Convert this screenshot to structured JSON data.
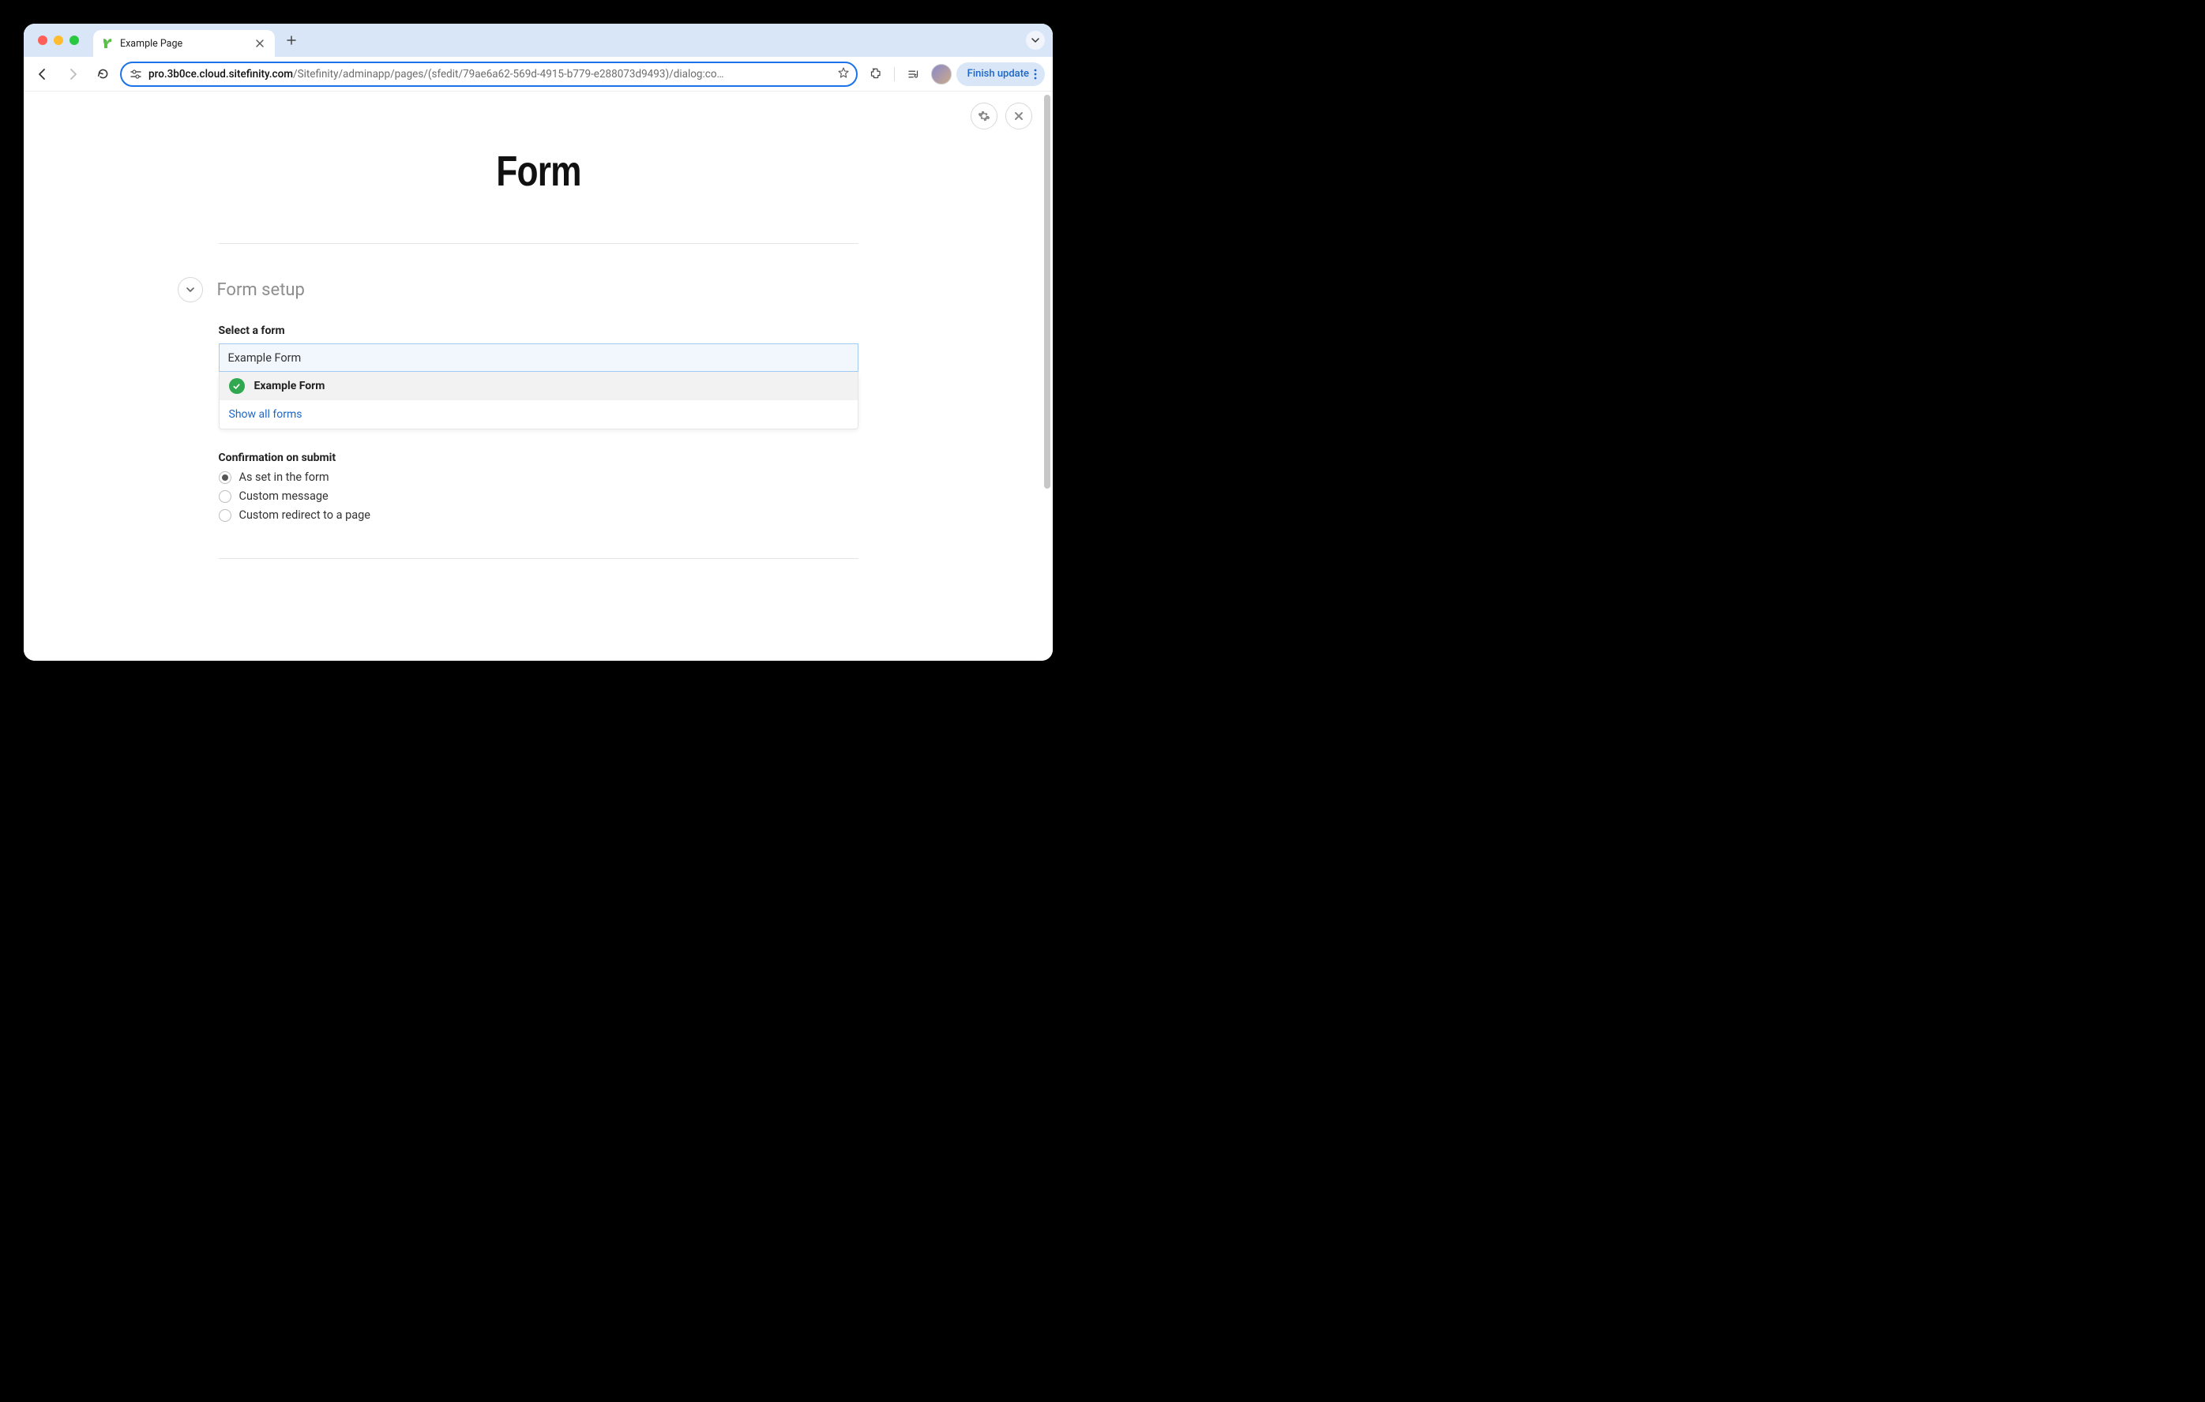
{
  "browser": {
    "tab_title": "Example Page",
    "url_domain": "pro.3b0ce.cloud.sitefinity.com",
    "url_path": "/Sitefinity/adminapp/pages/(sfedit/79ae6a62-569d-4915-b779-e288073d9493)/dialog:co…",
    "update_label": "Finish update"
  },
  "page": {
    "title": "Form"
  },
  "section": {
    "title": "Form setup",
    "select_form_label": "Select a form",
    "input_value": "Example Form",
    "dropdown_option": "Example Form",
    "show_all": "Show all forms"
  },
  "confirmation": {
    "group_label": "Confirmation on submit",
    "options": [
      {
        "label": "As set in the form",
        "checked": true
      },
      {
        "label": "Custom message",
        "checked": false
      },
      {
        "label": "Custom redirect to a page",
        "checked": false
      }
    ]
  }
}
